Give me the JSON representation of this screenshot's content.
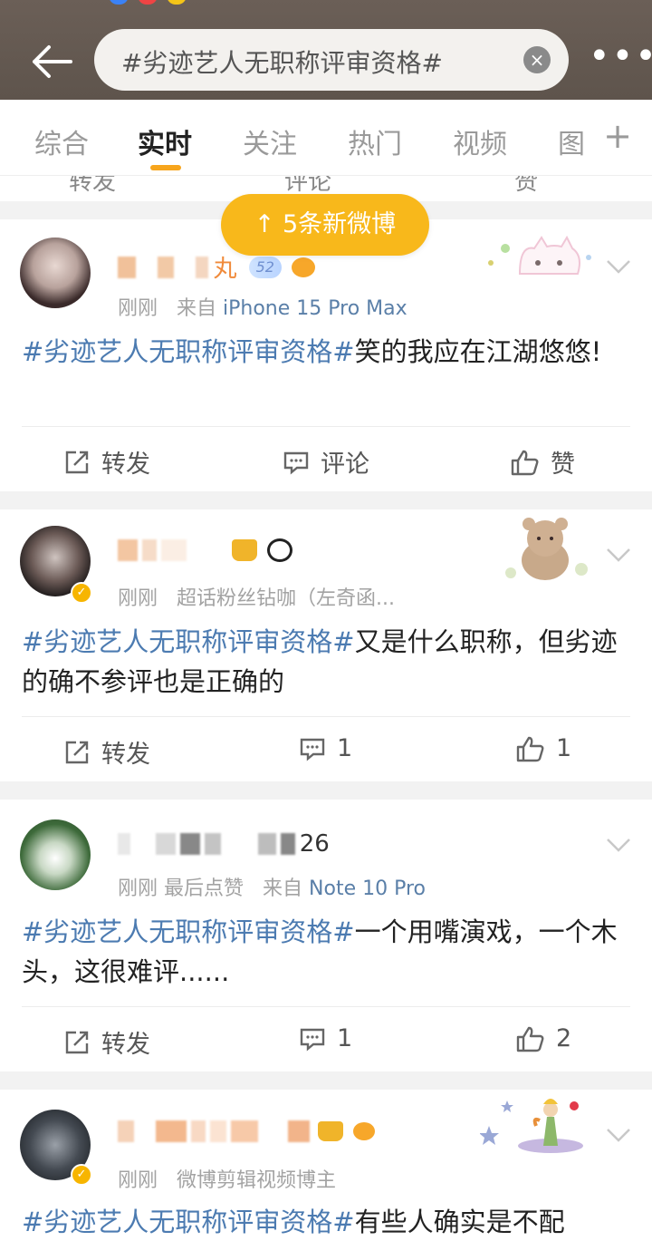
{
  "header": {
    "search_query": "#劣迹艺人无职称评审资格#",
    "clear_icon": "×",
    "more_icon": "•••"
  },
  "tabs": [
    {
      "label": "综合"
    },
    {
      "label": "实时"
    },
    {
      "label": "关注"
    },
    {
      "label": "热门"
    },
    {
      "label": "视频"
    },
    {
      "label": "图"
    }
  ],
  "tab_add": "+",
  "previous_post": {
    "repost": "转发",
    "comment": "评论",
    "like": "赞"
  },
  "new_posts_pill": "↑  5条新微博",
  "accent_color": "#f8b81b",
  "posts": [
    {
      "name_suffix": "丸",
      "badge": "52",
      "time": "刚刚",
      "source_prefix": "来自",
      "source": "iPhone 15 Pro Max",
      "tag": "#劣迹艺人无职称评审资格#",
      "text": "笑的我应在江湖悠悠!",
      "repost": "转发",
      "comment": "评论",
      "like": "赞"
    },
    {
      "time": "刚刚",
      "meta_text": "超话粉丝钻咖（左奇函...",
      "tag": "#劣迹艺人无职称评审资格#",
      "text": "又是什么职称，但劣迹的确不参评也是正确的",
      "repost": "转发",
      "comment": "1",
      "like": "1"
    },
    {
      "name_suffix": "26",
      "time": "刚刚",
      "meta_text": "最后点赞",
      "source_prefix": "来自",
      "source": "Note 10 Pro",
      "tag": "#劣迹艺人无职称评审资格#",
      "text": "一个用嘴演戏，一个木头，这很难评......",
      "repost": "转发",
      "comment": "1",
      "like": "2"
    },
    {
      "time": "刚刚",
      "meta_text": "微博剪辑视频博主",
      "tag": "#劣迹艺人无职称评审资格#",
      "text": "有些人确实是不配"
    }
  ]
}
